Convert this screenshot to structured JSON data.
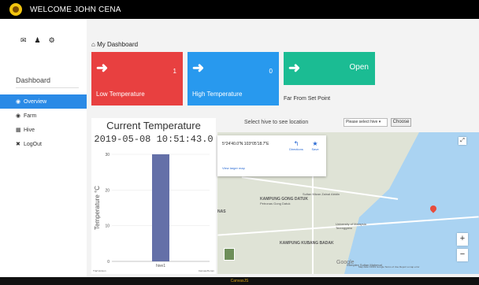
{
  "topbar": {
    "welcome": "WELCOME JOHN CENA"
  },
  "sidebar": {
    "icons": [
      "✉",
      "♟",
      "⚙"
    ],
    "title": "Dashboard",
    "items": [
      {
        "label": "Overview",
        "icon": "◉",
        "active": true
      },
      {
        "label": "Farm",
        "icon": "◉",
        "active": false
      },
      {
        "label": "Hive",
        "icon": "▦",
        "active": false
      },
      {
        "label": "LogOut",
        "icon": "✖",
        "active": false
      }
    ]
  },
  "main": {
    "heading": "My Dashboard",
    "cards": {
      "low": {
        "label": "Low Temperature",
        "count": "1"
      },
      "high": {
        "label": "High Temperature",
        "count": "0"
      },
      "far": {
        "status": "Open",
        "label": "Far From Set Point"
      }
    },
    "map": {
      "prompt": "Select hive to see location",
      "select_value": "Please select hive ▾",
      "choose_label": "Choose",
      "popup_coord": "5°24'40.0\"N 103°05'18.7\"E",
      "directions_label": "Directions",
      "save_label": "Save",
      "larger_map_label": "View larger map",
      "labels": {
        "kampung_gong_datuk": "KAMPUNG GONG DATUK",
        "kampung_kubang_badak": "KAMPUNG KUBANG BADAK",
        "nas": "NAS",
        "university": "University of Malaysia Terengganu",
        "petronas": "Petronas Gong Datuk",
        "sultan": "Sultan Mizan Zainal Abidin",
        "sultan_mizan": "Complex Sultan Mahmud"
      },
      "google": "Google",
      "footer": "Map data ©2019 Google  Terms of Use  Report a map error"
    }
  },
  "chart_data": {
    "type": "bar",
    "title": "Current Temperature",
    "subtitle": "2019-05-08 10:51:43.0",
    "categories": [
      "hive1"
    ],
    "values": [
      30
    ],
    "ylabel": "Temperature °C",
    "ylim": [
      0,
      30
    ],
    "yticks": [
      0,
      10,
      20,
      30
    ],
    "color": "#6470a8",
    "footer_left": "Trial Version",
    "footer_right": "CanvasJS.com"
  },
  "footer": {
    "text": "CanvasJS"
  }
}
